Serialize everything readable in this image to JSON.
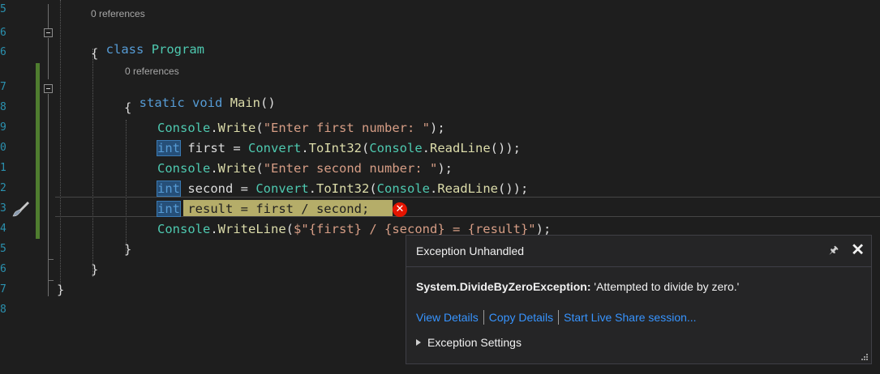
{
  "code_lens": {
    "class_refs": "0 references",
    "method_refs": "0 references"
  },
  "line_numbers": [
    "5",
    "6",
    "6",
    "7",
    "8",
    "9",
    "0",
    "1",
    "2",
    "3",
    "4",
    "5",
    "6",
    "7",
    "8"
  ],
  "code": {
    "class_kw": "class",
    "class_name": "Program",
    "brace_open_1": "{",
    "static_kw": "static",
    "void_kw": "void",
    "main_fn": "Main",
    "main_parens": "()",
    "brace_open_2": "{",
    "l1_console": "Console",
    "l1_dot": ".",
    "l1_write": "Write",
    "l1_open": "(",
    "l1_str": "\"Enter first number: \"",
    "l1_close": ");",
    "l2_int": "int",
    "l2_rest_a": " first = ",
    "l2_convert": "Convert",
    "l2_dot": ".",
    "l2_toint": "ToInt32",
    "l2_open": "(",
    "l2_console": "Console",
    "l2_dot2": ".",
    "l2_readline": "ReadLine",
    "l2_close": "());",
    "l3_console": "Console",
    "l3_dot": ".",
    "l3_write": "Write",
    "l3_open": "(",
    "l3_str": "\"Enter second number: \"",
    "l3_close": ");",
    "l4_int": "int",
    "l4_rest_a": " second = ",
    "l4_convert": "Convert",
    "l4_dot": ".",
    "l4_toint": "ToInt32",
    "l4_open": "(",
    "l4_console": "Console",
    "l4_dot2": ".",
    "l4_readline": "ReadLine",
    "l4_close": "());",
    "l5_int": "int",
    "l5_stmt": " result = first / second;",
    "l6_console": "Console",
    "l6_dot": ".",
    "l6_writeline": "WriteLine",
    "l6_open": "(",
    "l6_str": "$\"{first} / {second} = {result}\"",
    "l6_close": ");",
    "brace_close_2": "}",
    "brace_close_1": "}",
    "brace_close_0": "}"
  },
  "popup": {
    "title": "Exception Unhandled",
    "pin_icon": "pin-icon",
    "close_icon": "close-icon",
    "exception_type": "System.DivideByZeroException:",
    "exception_message": " 'Attempted to divide by zero.'",
    "link_view_details": "View Details",
    "link_copy_details": "Copy Details",
    "link_live_share": "Start Live Share session...",
    "settings_label": "Exception Settings"
  },
  "colors": {
    "background": "#1e1e1e",
    "current_statement": "#b5ad69",
    "error": "#e51400",
    "link": "#3794ff",
    "keyword": "#569cd6",
    "type": "#4ec9b0",
    "string": "#d69d85"
  }
}
